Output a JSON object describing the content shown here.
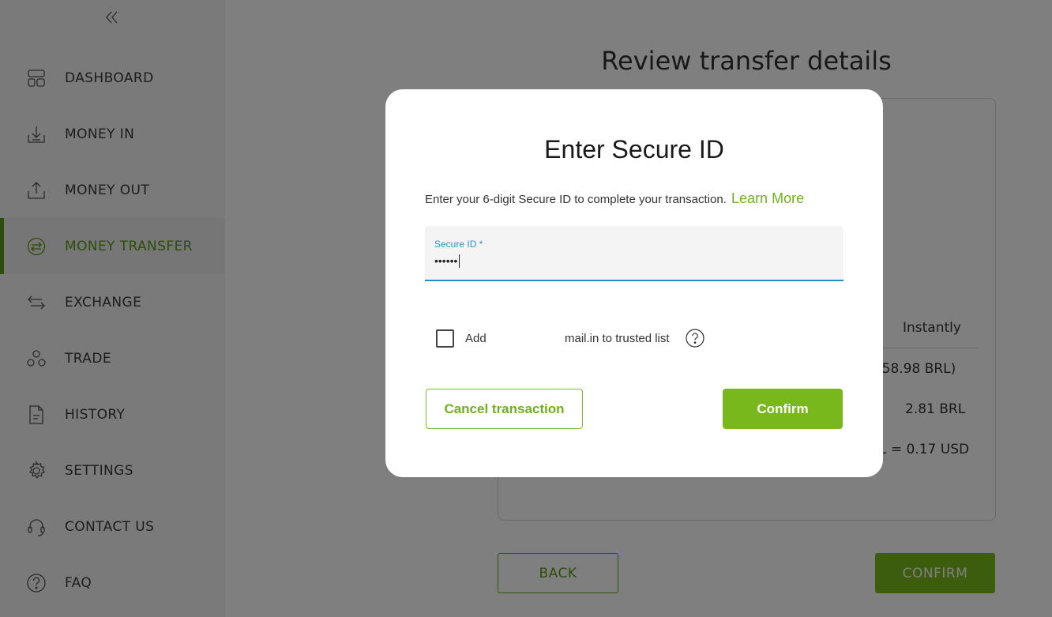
{
  "sidebar": {
    "collapse_icon": "double-chevron-left-icon",
    "items": [
      {
        "label": "DASHBOARD",
        "icon": "dashboard-icon",
        "active": false
      },
      {
        "label": "MONEY IN",
        "icon": "money-in-icon",
        "active": false
      },
      {
        "label": "MONEY OUT",
        "icon": "money-out-icon",
        "active": false
      },
      {
        "label": "MONEY TRANSFER",
        "icon": "money-transfer-icon",
        "active": true
      },
      {
        "label": "EXCHANGE",
        "icon": "exchange-icon",
        "active": false
      },
      {
        "label": "TRADE",
        "icon": "trade-icon",
        "active": false
      },
      {
        "label": "HISTORY",
        "icon": "history-icon",
        "active": false
      },
      {
        "label": "SETTINGS",
        "icon": "gear-icon",
        "active": false
      },
      {
        "label": "CONTACT US",
        "icon": "headset-icon",
        "active": false
      },
      {
        "label": "FAQ",
        "icon": "question-icon",
        "active": false
      }
    ]
  },
  "main": {
    "title": "Review transfer details",
    "details": {
      "speed": "Instantly",
      "amount_partial": "(58.98 BRL)",
      "fee": "2.81 BRL",
      "rate_partial": "L = 0.17 USD"
    },
    "back_label": "BACK",
    "confirm_label": "CONFIRM"
  },
  "modal": {
    "title": "Enter Secure ID",
    "description": "Enter your 6-digit Secure ID to complete your transaction.",
    "learn_more": "Learn More",
    "secure_field": {
      "label": "Secure ID *",
      "value": "••••••"
    },
    "trust": {
      "checked": false,
      "add": "Add",
      "text": "mail.in to trusted list"
    },
    "cancel_label": "Cancel transaction",
    "confirm_label": "Confirm"
  },
  "colors": {
    "accent_green": "#78b81c",
    "active_green": "#5b9a12",
    "field_blue": "#1f8fc4"
  }
}
